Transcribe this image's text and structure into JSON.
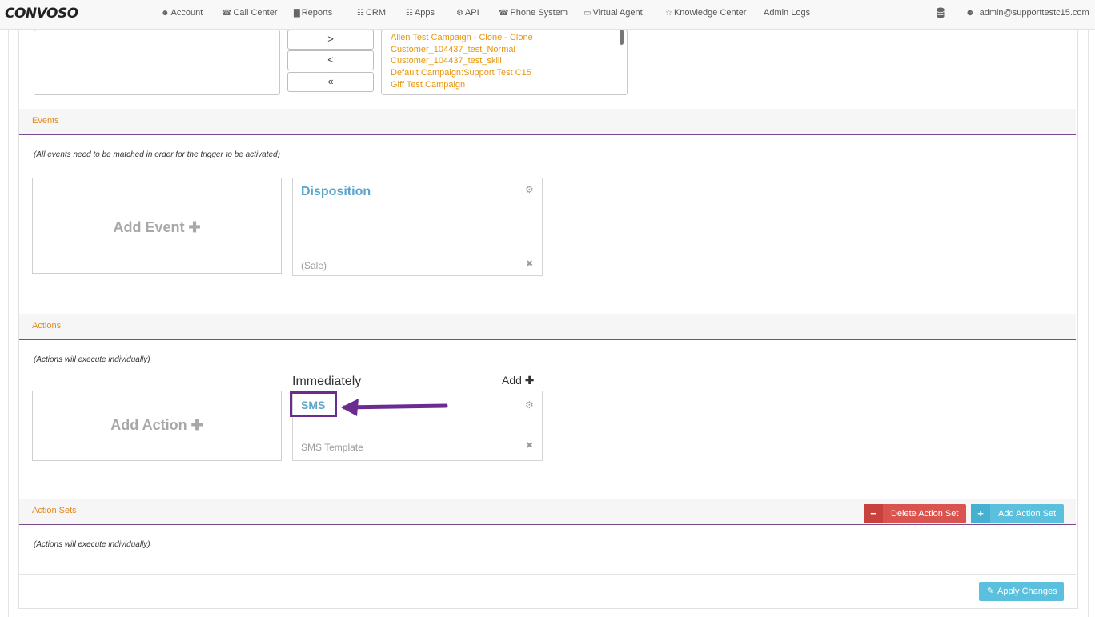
{
  "app": {
    "logo": "CONVOSO"
  },
  "nav": {
    "items": [
      {
        "label": "Account",
        "icon": "user-icon",
        "glyph": "☻"
      },
      {
        "label": "Call Center",
        "icon": "phone-icon",
        "glyph": "☎"
      },
      {
        "label": "Reports",
        "icon": "bar-chart-icon",
        "glyph": "▇"
      },
      {
        "label": "CRM",
        "icon": "table-icon",
        "glyph": "☷"
      },
      {
        "label": "Apps",
        "icon": "grid-icon",
        "glyph": "☷"
      },
      {
        "label": "API",
        "icon": "gear-icon",
        "glyph": "⚙"
      },
      {
        "label": "Phone System",
        "icon": "phone-icon",
        "glyph": "☎"
      },
      {
        "label": "Virtual Agent",
        "icon": "monitor-icon",
        "glyph": "▭"
      },
      {
        "label": "Knowledge Center",
        "icon": "lightbulb-icon",
        "glyph": "☆"
      },
      {
        "label": "Admin Logs",
        "icon": "",
        "glyph": ""
      }
    ],
    "user": "admin@supporttestc15.com"
  },
  "campaigns": {
    "move_buttons": [
      ">",
      "<",
      "«"
    ],
    "selected": [
      "Allen Test Campaign - Clone - Clone",
      "Customer_104437_test_Normal",
      "Customer_104437_test_skill",
      "Default Campaign:Support Test C15",
      "Giff Test Campaign"
    ]
  },
  "events": {
    "title": "Events",
    "note": "(All events need to be matched in order for the trigger to be activated)",
    "add_label": "Add Event ✚",
    "cards": [
      {
        "title": "Disposition",
        "subtitle": "(Sale)"
      }
    ]
  },
  "actions": {
    "title": "Actions",
    "note": "(Actions will execute individually)",
    "add_label": "Add Action ✚",
    "timing": "Immediately",
    "add_link": "Add ✚",
    "cards": [
      {
        "title": "SMS",
        "subtitle": "SMS Template"
      }
    ]
  },
  "action_sets": {
    "title": "Action Sets",
    "note": "(Actions will execute individually)",
    "delete_label": "Delete Action Set",
    "add_label": "Add Action Set"
  },
  "footer": {
    "apply_label": "Apply Changes"
  },
  "colors": {
    "accent_orange": "#e08a1e",
    "card_title_blue": "#5aa5c9",
    "highlight_purple": "#6a2c91",
    "delete_red": "#d9534f",
    "info_blue": "#5bc0de"
  }
}
